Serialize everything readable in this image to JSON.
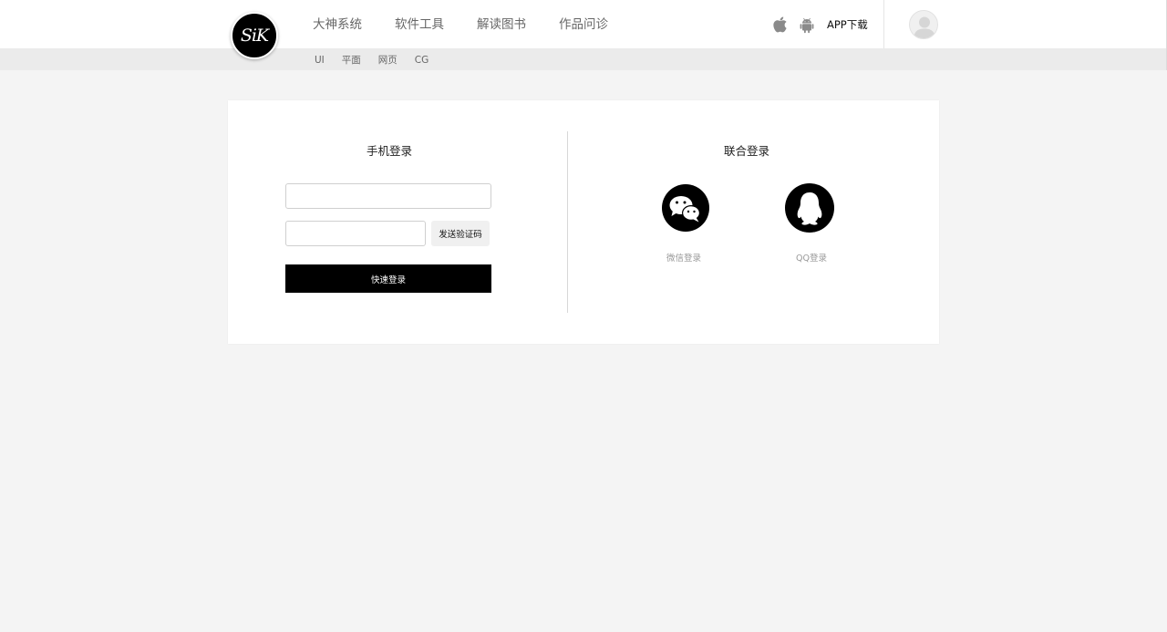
{
  "header": {
    "logo_text": "SiK",
    "nav": [
      {
        "label": "大神系统"
      },
      {
        "label": "软件工具"
      },
      {
        "label": "解读图书"
      },
      {
        "label": "作品问诊"
      }
    ],
    "subnav": [
      {
        "label": "UI"
      },
      {
        "label": "平面"
      },
      {
        "label": "网页"
      },
      {
        "label": "CG"
      }
    ],
    "app_download": "APP下载"
  },
  "login": {
    "phone_title": "手机登录",
    "phone_value": "",
    "code_value": "",
    "send_code_label": "发送验证码",
    "submit_label": "快速登录",
    "joint_title": "联合登录",
    "wechat_label": "微信登录",
    "qq_label": "QQ登录"
  },
  "colors": {
    "page_bg": "#f4f4f4",
    "subbar_bg": "#ebebeb",
    "primary_button": "#000000",
    "icon_gray": "#8a8a8a"
  },
  "icons": [
    "apple-icon",
    "android-icon",
    "avatar-icon",
    "wechat-icon",
    "qq-icon"
  ]
}
